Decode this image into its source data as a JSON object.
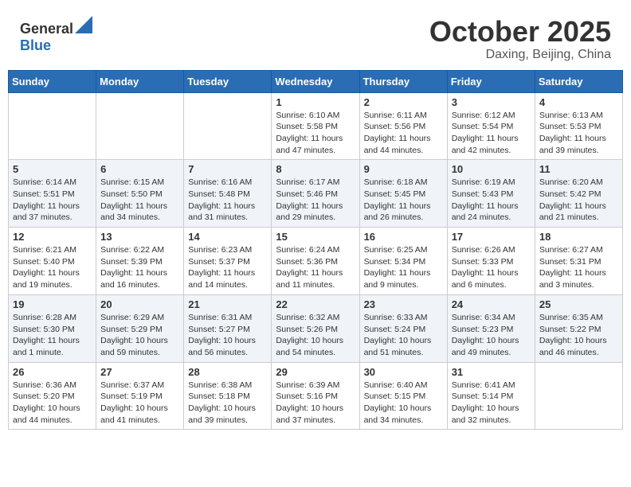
{
  "header": {
    "logo_general": "General",
    "logo_blue": "Blue",
    "month": "October 2025",
    "location": "Daxing, Beijing, China"
  },
  "weekdays": [
    "Sunday",
    "Monday",
    "Tuesday",
    "Wednesday",
    "Thursday",
    "Friday",
    "Saturday"
  ],
  "weeks": [
    [
      {
        "day": "",
        "info": ""
      },
      {
        "day": "",
        "info": ""
      },
      {
        "day": "",
        "info": ""
      },
      {
        "day": "1",
        "info": "Sunrise: 6:10 AM\nSunset: 5:58 PM\nDaylight: 11 hours and 47 minutes."
      },
      {
        "day": "2",
        "info": "Sunrise: 6:11 AM\nSunset: 5:56 PM\nDaylight: 11 hours and 44 minutes."
      },
      {
        "day": "3",
        "info": "Sunrise: 6:12 AM\nSunset: 5:54 PM\nDaylight: 11 hours and 42 minutes."
      },
      {
        "day": "4",
        "info": "Sunrise: 6:13 AM\nSunset: 5:53 PM\nDaylight: 11 hours and 39 minutes."
      }
    ],
    [
      {
        "day": "5",
        "info": "Sunrise: 6:14 AM\nSunset: 5:51 PM\nDaylight: 11 hours and 37 minutes."
      },
      {
        "day": "6",
        "info": "Sunrise: 6:15 AM\nSunset: 5:50 PM\nDaylight: 11 hours and 34 minutes."
      },
      {
        "day": "7",
        "info": "Sunrise: 6:16 AM\nSunset: 5:48 PM\nDaylight: 11 hours and 31 minutes."
      },
      {
        "day": "8",
        "info": "Sunrise: 6:17 AM\nSunset: 5:46 PM\nDaylight: 11 hours and 29 minutes."
      },
      {
        "day": "9",
        "info": "Sunrise: 6:18 AM\nSunset: 5:45 PM\nDaylight: 11 hours and 26 minutes."
      },
      {
        "day": "10",
        "info": "Sunrise: 6:19 AM\nSunset: 5:43 PM\nDaylight: 11 hours and 24 minutes."
      },
      {
        "day": "11",
        "info": "Sunrise: 6:20 AM\nSunset: 5:42 PM\nDaylight: 11 hours and 21 minutes."
      }
    ],
    [
      {
        "day": "12",
        "info": "Sunrise: 6:21 AM\nSunset: 5:40 PM\nDaylight: 11 hours and 19 minutes."
      },
      {
        "day": "13",
        "info": "Sunrise: 6:22 AM\nSunset: 5:39 PM\nDaylight: 11 hours and 16 minutes."
      },
      {
        "day": "14",
        "info": "Sunrise: 6:23 AM\nSunset: 5:37 PM\nDaylight: 11 hours and 14 minutes."
      },
      {
        "day": "15",
        "info": "Sunrise: 6:24 AM\nSunset: 5:36 PM\nDaylight: 11 hours and 11 minutes."
      },
      {
        "day": "16",
        "info": "Sunrise: 6:25 AM\nSunset: 5:34 PM\nDaylight: 11 hours and 9 minutes."
      },
      {
        "day": "17",
        "info": "Sunrise: 6:26 AM\nSunset: 5:33 PM\nDaylight: 11 hours and 6 minutes."
      },
      {
        "day": "18",
        "info": "Sunrise: 6:27 AM\nSunset: 5:31 PM\nDaylight: 11 hours and 3 minutes."
      }
    ],
    [
      {
        "day": "19",
        "info": "Sunrise: 6:28 AM\nSunset: 5:30 PM\nDaylight: 11 hours and 1 minute."
      },
      {
        "day": "20",
        "info": "Sunrise: 6:29 AM\nSunset: 5:29 PM\nDaylight: 10 hours and 59 minutes."
      },
      {
        "day": "21",
        "info": "Sunrise: 6:31 AM\nSunset: 5:27 PM\nDaylight: 10 hours and 56 minutes."
      },
      {
        "day": "22",
        "info": "Sunrise: 6:32 AM\nSunset: 5:26 PM\nDaylight: 10 hours and 54 minutes."
      },
      {
        "day": "23",
        "info": "Sunrise: 6:33 AM\nSunset: 5:24 PM\nDaylight: 10 hours and 51 minutes."
      },
      {
        "day": "24",
        "info": "Sunrise: 6:34 AM\nSunset: 5:23 PM\nDaylight: 10 hours and 49 minutes."
      },
      {
        "day": "25",
        "info": "Sunrise: 6:35 AM\nSunset: 5:22 PM\nDaylight: 10 hours and 46 minutes."
      }
    ],
    [
      {
        "day": "26",
        "info": "Sunrise: 6:36 AM\nSunset: 5:20 PM\nDaylight: 10 hours and 44 minutes."
      },
      {
        "day": "27",
        "info": "Sunrise: 6:37 AM\nSunset: 5:19 PM\nDaylight: 10 hours and 41 minutes."
      },
      {
        "day": "28",
        "info": "Sunrise: 6:38 AM\nSunset: 5:18 PM\nDaylight: 10 hours and 39 minutes."
      },
      {
        "day": "29",
        "info": "Sunrise: 6:39 AM\nSunset: 5:16 PM\nDaylight: 10 hours and 37 minutes."
      },
      {
        "day": "30",
        "info": "Sunrise: 6:40 AM\nSunset: 5:15 PM\nDaylight: 10 hours and 34 minutes."
      },
      {
        "day": "31",
        "info": "Sunrise: 6:41 AM\nSunset: 5:14 PM\nDaylight: 10 hours and 32 minutes."
      },
      {
        "day": "",
        "info": ""
      }
    ]
  ]
}
